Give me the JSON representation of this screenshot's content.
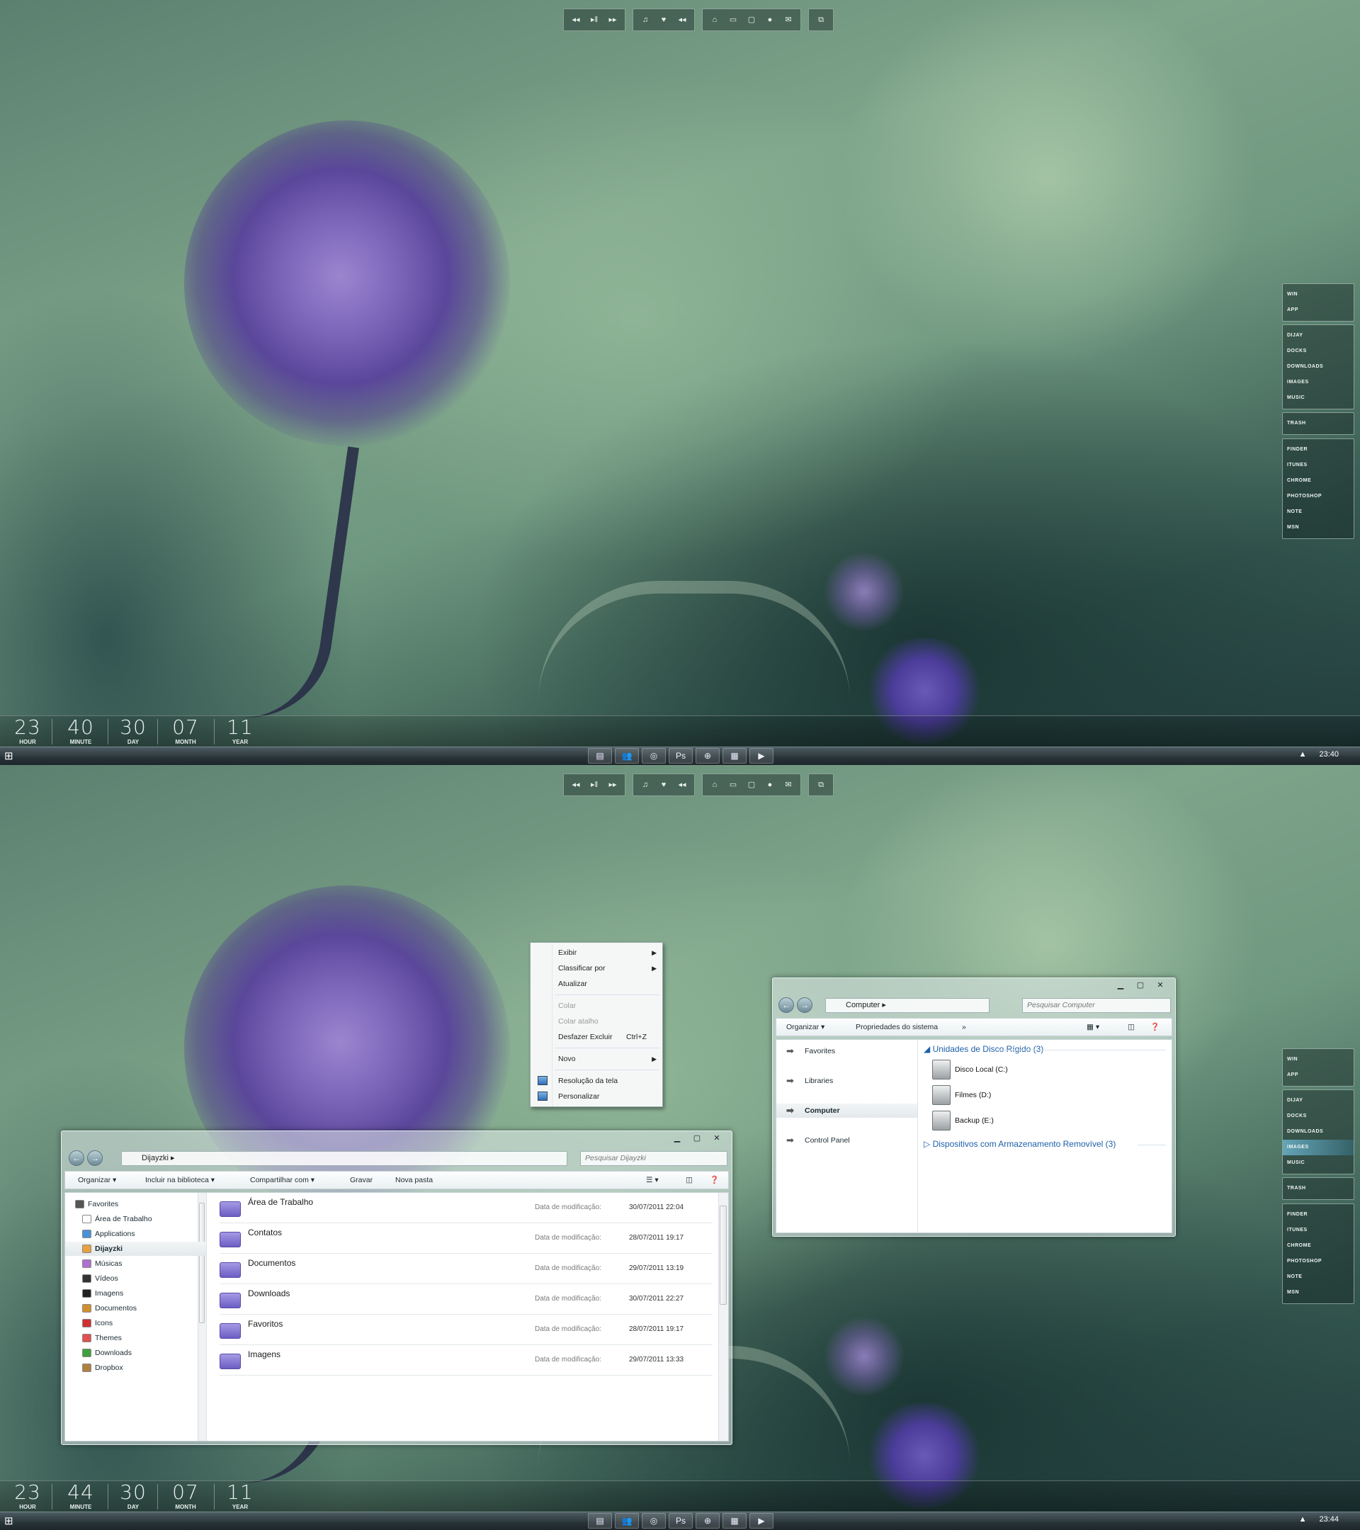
{
  "topbar": {
    "groups": [
      [
        "◂◂",
        "▸‖",
        "▸▸"
      ],
      [
        "♫",
        "♥",
        "◂◂"
      ],
      [
        "⌂",
        "▭",
        "▢",
        "●",
        "✉"
      ],
      [
        "⧉"
      ]
    ]
  },
  "dock": {
    "panel1": [
      "WIN",
      "APP"
    ],
    "panel2": [
      "DIJAY",
      "DOCKS",
      "DOWNLOADS",
      "IMAGES",
      "MUSIC"
    ],
    "panel3": [
      "TRASH"
    ],
    "panel4": [
      "FINDER",
      "ITUNES",
      "CHROME",
      "PHOTOSHOP",
      "NOTE",
      "MSN"
    ]
  },
  "screen1": {
    "clock": {
      "hour": "23",
      "minute": "40",
      "day": "30",
      "month": "07",
      "year": "11",
      "labels": {
        "hour": "HOUR",
        "minute": "MINUTE",
        "day": "DAY",
        "month": "MONTH",
        "year": "YEAR"
      }
    },
    "tray_time": "23:40"
  },
  "screen2": {
    "clock": {
      "hour": "23",
      "minute": "44",
      "day": "30",
      "month": "07",
      "year": "11",
      "labels": {
        "hour": "HOUR",
        "minute": "MINUTE",
        "day": "DAY",
        "month": "MONTH",
        "year": "YEAR"
      }
    },
    "tray_time": "23:44"
  },
  "taskbar": {
    "start_icon": "windows-logo",
    "tray_arrow": "▲",
    "items": [
      "▤",
      "👥",
      "◎",
      "Ps",
      "⊕",
      "▦",
      "▶"
    ]
  },
  "context_menu": {
    "items": [
      {
        "label": "Exibir",
        "submenu": true
      },
      {
        "label": "Classificar por",
        "submenu": true
      },
      {
        "label": "Atualizar"
      },
      {
        "label": "Colar",
        "disabled": true
      },
      {
        "label": "Colar atalho",
        "disabled": true
      },
      {
        "label": "Desfazer Excluir",
        "shortcut": "Ctrl+Z"
      },
      {
        "label": "Novo",
        "submenu": true
      },
      {
        "label": "Resolução da tela"
      },
      {
        "label": "Personalizar"
      }
    ]
  },
  "explorer1": {
    "address": "Dijayzki",
    "search_placeholder": "Pesquisar Dijayzki",
    "commands": [
      "Organizar",
      "Incluir na biblioteca",
      "Compartilhar com",
      "Gravar",
      "Nova pasta"
    ],
    "sidebar": [
      {
        "label": "Favorites",
        "color": "#555"
      },
      {
        "label": "Área de Trabalho",
        "color": "#fff"
      },
      {
        "label": "Applications",
        "color": "#4a90d8"
      },
      {
        "label": "Dijayzki",
        "color": "#e8a040",
        "selected": true
      },
      {
        "label": "Músicas",
        "color": "#b070d0"
      },
      {
        "label": "Vídeos",
        "color": "#333"
      },
      {
        "label": "Imagens",
        "color": "#222"
      },
      {
        "label": "Documentos",
        "color": "#d09030"
      },
      {
        "label": "Icons",
        "color": "#d03030"
      },
      {
        "label": "Themes",
        "color": "#e05050"
      },
      {
        "label": "Downloads",
        "color": "#40a040"
      },
      {
        "label": "Dropbox",
        "color": "#b08040"
      }
    ],
    "date_label": "Data de modificação:",
    "files": [
      {
        "name": "Área de Trabalho",
        "date": "30/07/2011 22:04"
      },
      {
        "name": "Contatos",
        "date": "28/07/2011 19:17"
      },
      {
        "name": "Documentos",
        "date": "29/07/2011 13:19"
      },
      {
        "name": "Downloads",
        "date": "30/07/2011 22:27"
      },
      {
        "name": "Favoritos",
        "date": "28/07/2011 19:17"
      },
      {
        "name": "Imagens",
        "date": "29/07/2011 13:33"
      }
    ]
  },
  "explorer2": {
    "address": "Computer",
    "search_placeholder": "Pesquisar Computer",
    "commands": [
      "Organizar",
      "Propriedades do sistema",
      "»"
    ],
    "sidebar": [
      "Favorites",
      "Libraries",
      "Computer",
      "Control Panel"
    ],
    "group1": "Unidades de Disco Rígido (3)",
    "drives": [
      "Disco Local (C:)",
      "Filmes (D:)",
      "Backup (E:)"
    ],
    "group2": "Dispositivos com Armazenamento Removível (3)"
  }
}
